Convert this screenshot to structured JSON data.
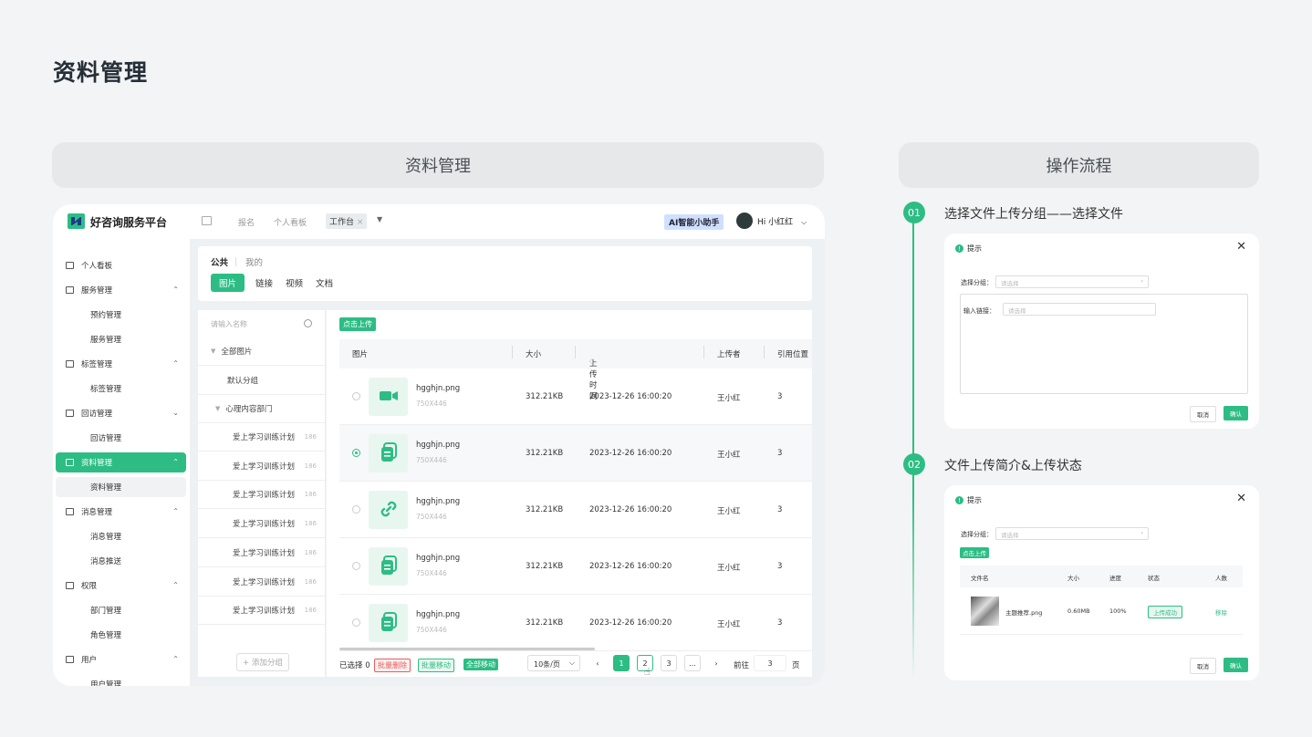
{
  "page": {
    "title": "资料管理"
  },
  "section_left": {
    "header": "资料管理"
  },
  "section_right": {
    "header": "操作流程"
  },
  "app": {
    "logo_text": "好咨询服务平台",
    "nav": [
      "报名",
      "个人看板"
    ],
    "active_tab": "工作台",
    "ai_button": "AI智能小助手",
    "user": "Hi 小红红"
  },
  "sidebar": {
    "items": [
      {
        "label": "个人看板",
        "type": "item"
      },
      {
        "label": "服务管理",
        "type": "item",
        "chevron": "^"
      },
      {
        "label": "预约管理",
        "type": "sub"
      },
      {
        "label": "服务管理",
        "type": "sub"
      },
      {
        "label": "标签管理",
        "type": "item",
        "chevron": "^"
      },
      {
        "label": "标签管理",
        "type": "sub"
      },
      {
        "label": "回访管理",
        "type": "item",
        "chevron": "v"
      },
      {
        "label": "回访管理",
        "type": "sub"
      },
      {
        "label": "资料管理",
        "type": "item",
        "chevron": "^",
        "active": true
      },
      {
        "label": "资料管理",
        "type": "sub",
        "active": true
      },
      {
        "label": "消息管理",
        "type": "item",
        "chevron": "^"
      },
      {
        "label": "消息管理",
        "type": "sub"
      },
      {
        "label": "消息推送",
        "type": "sub"
      },
      {
        "label": "权限",
        "type": "item",
        "chevron": "^"
      },
      {
        "label": "部门管理",
        "type": "sub"
      },
      {
        "label": "角色管理",
        "type": "sub"
      },
      {
        "label": "用户",
        "type": "item",
        "chevron": "^"
      },
      {
        "label": "用户管理",
        "type": "sub"
      }
    ]
  },
  "scope_tabs": {
    "public": "公共",
    "mine": "我的"
  },
  "type_tabs": [
    "图片",
    "链接",
    "视频",
    "文档"
  ],
  "groups": {
    "search_placeholder": "请输入名称",
    "all": "全部图片",
    "default": "默认分组",
    "dept": "心理内容部门",
    "items": [
      {
        "label": "爱上学习训练计划",
        "count": "186"
      },
      {
        "label": "爱上学习训练计划",
        "count": "186"
      },
      {
        "label": "爱上学习训练计划",
        "count": "186"
      },
      {
        "label": "爱上学习训练计划",
        "count": "186"
      },
      {
        "label": "爱上学习训练计划",
        "count": "186"
      },
      {
        "label": "爱上学习训练计划",
        "count": "186"
      },
      {
        "label": "爱上学习训练计划",
        "count": "186"
      }
    ],
    "add": "+ 添加分组"
  },
  "table": {
    "upload": "点击上传",
    "columns": [
      "图片",
      "大小",
      "上传时间",
      "上传者",
      "引用位置"
    ],
    "rows": [
      {
        "name": "hgghjn.png",
        "dim": "750X446",
        "size": "312.21KB",
        "time": "2023-12-26 16:00:20",
        "uploader": "王小红",
        "refs": "3",
        "icon": "video-icon"
      },
      {
        "name": "hgghjn.png",
        "dim": "750X446",
        "size": "312.21KB",
        "time": "2023-12-26 16:00:20",
        "uploader": "王小红",
        "refs": "3",
        "icon": "document-icon",
        "selected": true
      },
      {
        "name": "hgghjn.png",
        "dim": "750X446",
        "size": "312.21KB",
        "time": "2023-12-26 16:00:20",
        "uploader": "王小红",
        "refs": "3",
        "icon": "link-icon"
      },
      {
        "name": "hgghjn.png",
        "dim": "750X446",
        "size": "312.21KB",
        "time": "2023-12-26 16:00:20",
        "uploader": "王小红",
        "refs": "3",
        "icon": "document-icon"
      },
      {
        "name": "hgghjn.png",
        "dim": "750X446",
        "size": "312.21KB",
        "time": "2023-12-26 16:00:20",
        "uploader": "王小红",
        "refs": "3",
        "icon": "document-icon"
      }
    ]
  },
  "footer": {
    "selected": "已选择 0",
    "batch_delete": "批量删除",
    "batch_move": "批量移动",
    "move_all": "全部移动",
    "page_size": "10条/页",
    "pages": [
      "1",
      "2",
      "3",
      "..."
    ],
    "goto": "前往",
    "goto_value": "3",
    "page_unit": "页"
  },
  "steps": [
    {
      "num": "01",
      "title": "选择文件上传分组——选择文件"
    },
    {
      "num": "02",
      "title": "文件上传简介&上传状态"
    }
  ],
  "dialog1": {
    "title": "提示",
    "group_label": "选择分组：",
    "group_placeholder": "请选择",
    "link_label": "输入链接：",
    "link_placeholder": "请选择",
    "cancel": "取消",
    "confirm": "确认"
  },
  "dialog2": {
    "title": "提示",
    "group_label": "选择分组：",
    "group_placeholder": "请选择",
    "upload": "点击上传",
    "columns": [
      "文件名",
      "大小",
      "进度",
      "状态",
      "人数"
    ],
    "row": {
      "name": "主题推荐.png",
      "size": "0.60MB",
      "progress": "100%",
      "status": "上传成功",
      "action": "移除"
    },
    "cancel": "取消",
    "confirm": "确认"
  },
  "colors": {
    "accent": "#2dbd84",
    "danger": "#e85d5d"
  }
}
